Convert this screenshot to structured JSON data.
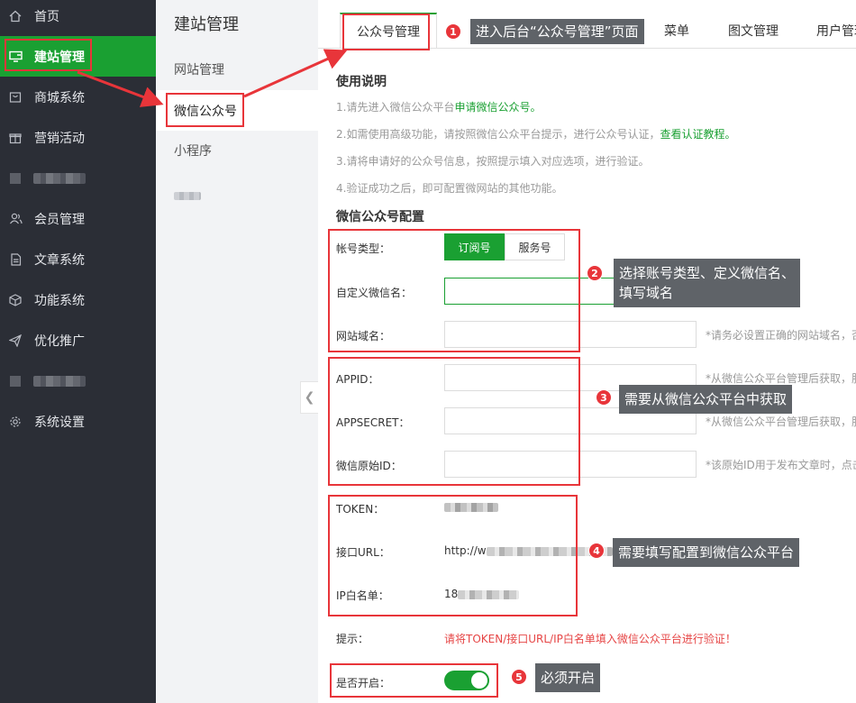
{
  "nav": {
    "items": [
      {
        "label": "首页",
        "icon": "home-icon"
      },
      {
        "label": "建站管理",
        "icon": "monitor-icon"
      },
      {
        "label": "商城系统",
        "icon": "cart-icon"
      },
      {
        "label": "营销活动",
        "icon": "gift-icon"
      },
      {
        "label": "",
        "icon": "blurred-icon"
      },
      {
        "label": "会员管理",
        "icon": "users-icon"
      },
      {
        "label": "文章系统",
        "icon": "document-icon"
      },
      {
        "label": "功能系统",
        "icon": "cube-icon"
      },
      {
        "label": "优化推广",
        "icon": "send-icon"
      },
      {
        "label": "",
        "icon": "blurred-icon"
      },
      {
        "label": "系统设置",
        "icon": "gear-icon"
      }
    ]
  },
  "submenu": {
    "title": "建站管理",
    "items": [
      "网站管理",
      "微信公众号",
      "小程序"
    ]
  },
  "tabs": [
    "公众号管理",
    "菜单",
    "图文管理",
    "用户管理"
  ],
  "usage": {
    "title": "使用说明",
    "line1_pre": "1.请先进入微信公众平台",
    "line1_link": "申请微信公众号。",
    "line2_pre": "2.如需使用高级功能，请按照微信公众平台提示，进行公众号认证，",
    "line2_link": "查看认证教程。",
    "line3": "3.请将申请好的公众号信息，按照提示填入对应选项，进行验证。",
    "line4": "4.验证成功之后，即可配置微网站的其他功能。"
  },
  "config": {
    "title": "微信公众号配置",
    "account_type_label": "帐号类型：",
    "type_subscribe": "订阅号",
    "type_service": "服务号",
    "custom_name_label": "自定义微信名：",
    "domain_label": "网站域名：",
    "domain_hint": "*请务必设置正确的网站域名，否",
    "appid_label": "APPID：",
    "appid_hint": "*从微信公众平台管理后获取，服",
    "appsecret_label": "APPSECRET：",
    "appsecret_hint": "*从微信公众平台管理后获取，服",
    "original_id_label": "微信原始ID：",
    "original_id_hint": "*该原始ID用于发布文章时，点击",
    "token_label": "TOKEN：",
    "url_label": "接口URL：",
    "url_value": "http://w",
    "ip_label": "IP白名单：",
    "ip_value": "18",
    "tip_label": "提示：",
    "tip_text": "请将TOKEN/接口URL/IP白名单填入微信公众平台进行验证！",
    "enable_label": "是否开启：",
    "enabled": true
  },
  "annotations": [
    {
      "num": "1",
      "text": "进入后台“公众号管理”页面"
    },
    {
      "num": "2",
      "text": "选择账号类型、定义微信名、填写域名",
      "line1": "选择账号类型、定义微信名、",
      "line2": "填写域名"
    },
    {
      "num": "3",
      "text": "需要从微信公众平台中获取"
    },
    {
      "num": "4",
      "text": "需要填写配置到微信公众平台"
    },
    {
      "num": "5",
      "text": "必须开启"
    }
  ],
  "colors": {
    "brand_green": "#1aa032",
    "annotation_red": "#e8353a",
    "nav_bg": "#2b2e36"
  }
}
